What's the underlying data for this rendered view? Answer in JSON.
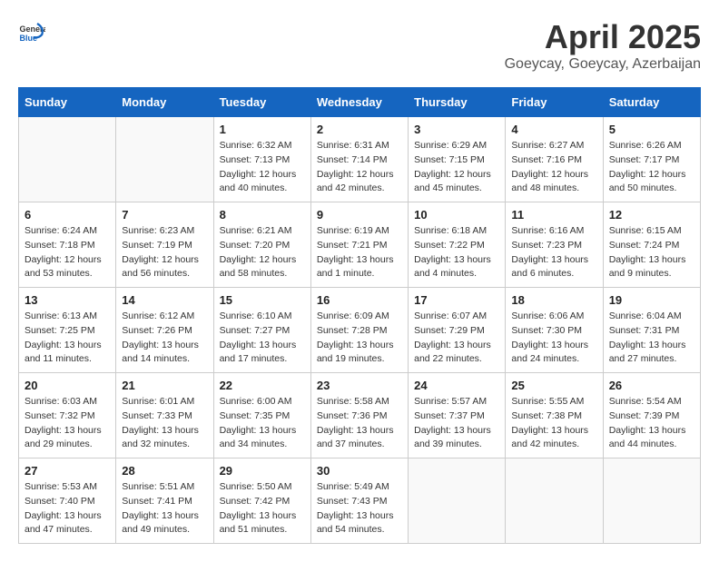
{
  "header": {
    "logo_general": "General",
    "logo_blue": "Blue",
    "month": "April 2025",
    "location": "Goeycay, Goeycay, Azerbaijan"
  },
  "weekdays": [
    "Sunday",
    "Monday",
    "Tuesday",
    "Wednesday",
    "Thursday",
    "Friday",
    "Saturday"
  ],
  "weeks": [
    [
      {
        "day": null
      },
      {
        "day": null
      },
      {
        "day": "1",
        "sunrise": "Sunrise: 6:32 AM",
        "sunset": "Sunset: 7:13 PM",
        "daylight": "Daylight: 12 hours and 40 minutes."
      },
      {
        "day": "2",
        "sunrise": "Sunrise: 6:31 AM",
        "sunset": "Sunset: 7:14 PM",
        "daylight": "Daylight: 12 hours and 42 minutes."
      },
      {
        "day": "3",
        "sunrise": "Sunrise: 6:29 AM",
        "sunset": "Sunset: 7:15 PM",
        "daylight": "Daylight: 12 hours and 45 minutes."
      },
      {
        "day": "4",
        "sunrise": "Sunrise: 6:27 AM",
        "sunset": "Sunset: 7:16 PM",
        "daylight": "Daylight: 12 hours and 48 minutes."
      },
      {
        "day": "5",
        "sunrise": "Sunrise: 6:26 AM",
        "sunset": "Sunset: 7:17 PM",
        "daylight": "Daylight: 12 hours and 50 minutes."
      }
    ],
    [
      {
        "day": "6",
        "sunrise": "Sunrise: 6:24 AM",
        "sunset": "Sunset: 7:18 PM",
        "daylight": "Daylight: 12 hours and 53 minutes."
      },
      {
        "day": "7",
        "sunrise": "Sunrise: 6:23 AM",
        "sunset": "Sunset: 7:19 PM",
        "daylight": "Daylight: 12 hours and 56 minutes."
      },
      {
        "day": "8",
        "sunrise": "Sunrise: 6:21 AM",
        "sunset": "Sunset: 7:20 PM",
        "daylight": "Daylight: 12 hours and 58 minutes."
      },
      {
        "day": "9",
        "sunrise": "Sunrise: 6:19 AM",
        "sunset": "Sunset: 7:21 PM",
        "daylight": "Daylight: 13 hours and 1 minute."
      },
      {
        "day": "10",
        "sunrise": "Sunrise: 6:18 AM",
        "sunset": "Sunset: 7:22 PM",
        "daylight": "Daylight: 13 hours and 4 minutes."
      },
      {
        "day": "11",
        "sunrise": "Sunrise: 6:16 AM",
        "sunset": "Sunset: 7:23 PM",
        "daylight": "Daylight: 13 hours and 6 minutes."
      },
      {
        "day": "12",
        "sunrise": "Sunrise: 6:15 AM",
        "sunset": "Sunset: 7:24 PM",
        "daylight": "Daylight: 13 hours and 9 minutes."
      }
    ],
    [
      {
        "day": "13",
        "sunrise": "Sunrise: 6:13 AM",
        "sunset": "Sunset: 7:25 PM",
        "daylight": "Daylight: 13 hours and 11 minutes."
      },
      {
        "day": "14",
        "sunrise": "Sunrise: 6:12 AM",
        "sunset": "Sunset: 7:26 PM",
        "daylight": "Daylight: 13 hours and 14 minutes."
      },
      {
        "day": "15",
        "sunrise": "Sunrise: 6:10 AM",
        "sunset": "Sunset: 7:27 PM",
        "daylight": "Daylight: 13 hours and 17 minutes."
      },
      {
        "day": "16",
        "sunrise": "Sunrise: 6:09 AM",
        "sunset": "Sunset: 7:28 PM",
        "daylight": "Daylight: 13 hours and 19 minutes."
      },
      {
        "day": "17",
        "sunrise": "Sunrise: 6:07 AM",
        "sunset": "Sunset: 7:29 PM",
        "daylight": "Daylight: 13 hours and 22 minutes."
      },
      {
        "day": "18",
        "sunrise": "Sunrise: 6:06 AM",
        "sunset": "Sunset: 7:30 PM",
        "daylight": "Daylight: 13 hours and 24 minutes."
      },
      {
        "day": "19",
        "sunrise": "Sunrise: 6:04 AM",
        "sunset": "Sunset: 7:31 PM",
        "daylight": "Daylight: 13 hours and 27 minutes."
      }
    ],
    [
      {
        "day": "20",
        "sunrise": "Sunrise: 6:03 AM",
        "sunset": "Sunset: 7:32 PM",
        "daylight": "Daylight: 13 hours and 29 minutes."
      },
      {
        "day": "21",
        "sunrise": "Sunrise: 6:01 AM",
        "sunset": "Sunset: 7:33 PM",
        "daylight": "Daylight: 13 hours and 32 minutes."
      },
      {
        "day": "22",
        "sunrise": "Sunrise: 6:00 AM",
        "sunset": "Sunset: 7:35 PM",
        "daylight": "Daylight: 13 hours and 34 minutes."
      },
      {
        "day": "23",
        "sunrise": "Sunrise: 5:58 AM",
        "sunset": "Sunset: 7:36 PM",
        "daylight": "Daylight: 13 hours and 37 minutes."
      },
      {
        "day": "24",
        "sunrise": "Sunrise: 5:57 AM",
        "sunset": "Sunset: 7:37 PM",
        "daylight": "Daylight: 13 hours and 39 minutes."
      },
      {
        "day": "25",
        "sunrise": "Sunrise: 5:55 AM",
        "sunset": "Sunset: 7:38 PM",
        "daylight": "Daylight: 13 hours and 42 minutes."
      },
      {
        "day": "26",
        "sunrise": "Sunrise: 5:54 AM",
        "sunset": "Sunset: 7:39 PM",
        "daylight": "Daylight: 13 hours and 44 minutes."
      }
    ],
    [
      {
        "day": "27",
        "sunrise": "Sunrise: 5:53 AM",
        "sunset": "Sunset: 7:40 PM",
        "daylight": "Daylight: 13 hours and 47 minutes."
      },
      {
        "day": "28",
        "sunrise": "Sunrise: 5:51 AM",
        "sunset": "Sunset: 7:41 PM",
        "daylight": "Daylight: 13 hours and 49 minutes."
      },
      {
        "day": "29",
        "sunrise": "Sunrise: 5:50 AM",
        "sunset": "Sunset: 7:42 PM",
        "daylight": "Daylight: 13 hours and 51 minutes."
      },
      {
        "day": "30",
        "sunrise": "Sunrise: 5:49 AM",
        "sunset": "Sunset: 7:43 PM",
        "daylight": "Daylight: 13 hours and 54 minutes."
      },
      {
        "day": null
      },
      {
        "day": null
      },
      {
        "day": null
      }
    ]
  ]
}
